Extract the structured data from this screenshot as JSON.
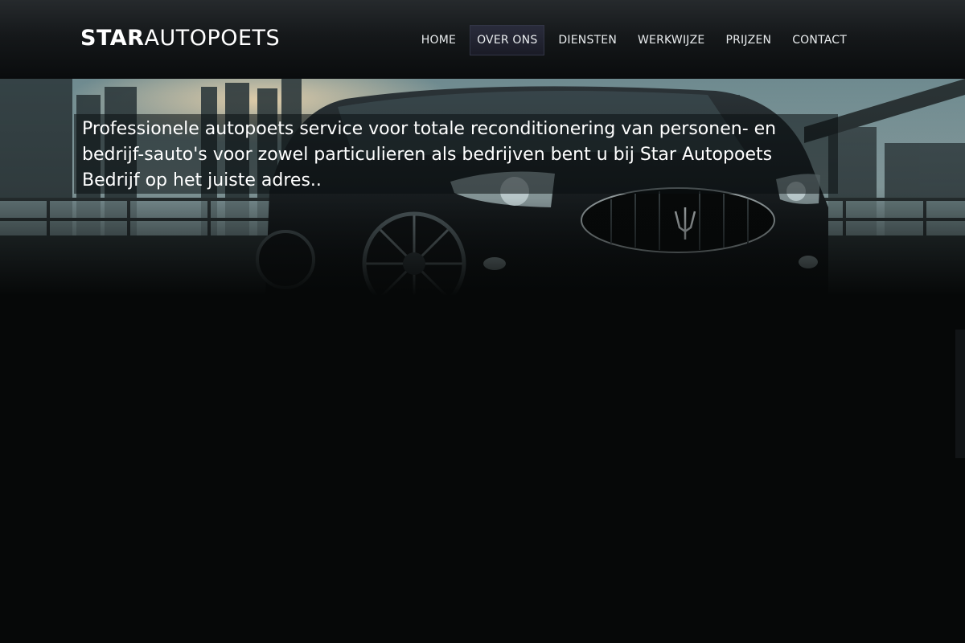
{
  "brand": {
    "logo_bold": "STAR",
    "logo_light": "AUTOPOETS"
  },
  "nav": {
    "items": [
      {
        "label": "HOME",
        "active": false
      },
      {
        "label": "OVER ONS",
        "active": true
      },
      {
        "label": "DIENSTEN",
        "active": false
      },
      {
        "label": "WERKWIJZE",
        "active": false
      },
      {
        "label": "PRIJZEN",
        "active": false
      },
      {
        "label": "CONTACT",
        "active": false
      }
    ]
  },
  "hero": {
    "tagline": "Professionele autopoets service voor totale reconditionering van personen- en bedrijf-sauto's voor zowel particulieren als bedrijven bent u bij Star Autopoets Bedrijf op het juiste adres.."
  },
  "colors": {
    "page_background": "#060808",
    "header_top": "#262a2d",
    "active_nav": "#2a2c3c"
  }
}
